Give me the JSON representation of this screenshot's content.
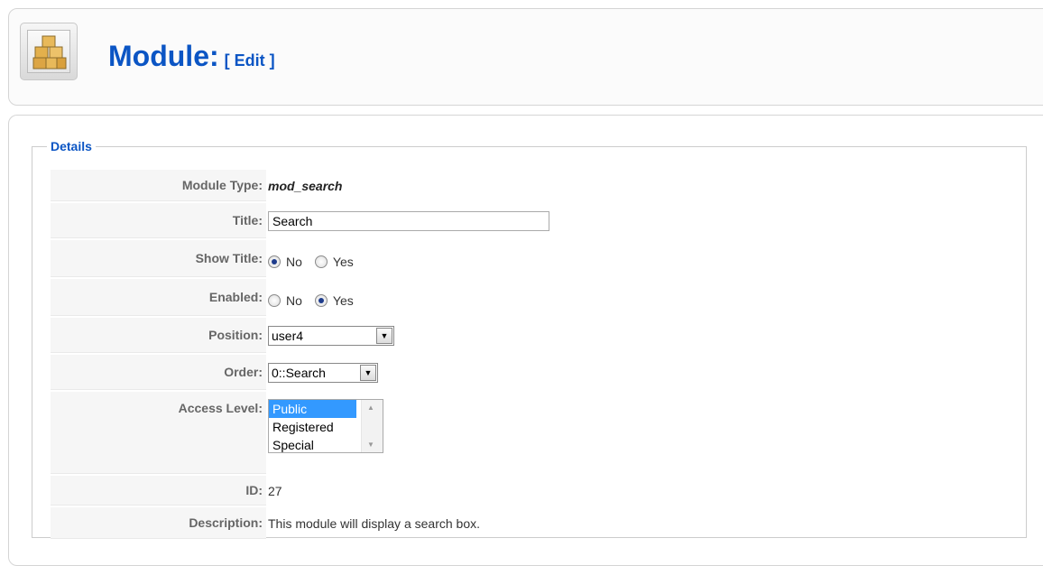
{
  "header": {
    "title": "Module:",
    "subtitle": "[ Edit ]"
  },
  "details": {
    "legend": "Details",
    "module_type": {
      "label": "Module Type:",
      "value": "mod_search"
    },
    "title": {
      "label": "Title:",
      "value": "Search"
    },
    "show_title": {
      "label": "Show Title:",
      "options": [
        "No",
        "Yes"
      ],
      "selected": "No"
    },
    "enabled": {
      "label": "Enabled:",
      "options": [
        "No",
        "Yes"
      ],
      "selected": "Yes"
    },
    "position": {
      "label": "Position:",
      "value": "user4"
    },
    "order": {
      "label": "Order:",
      "value": "0::Search"
    },
    "access_level": {
      "label": "Access Level:",
      "options": [
        "Public",
        "Registered",
        "Special"
      ],
      "selected": "Public"
    },
    "id": {
      "label": "ID:",
      "value": "27"
    },
    "description": {
      "label": "Description:",
      "value": "This module will display a search box."
    }
  },
  "colors": {
    "title": "#0b55c4",
    "selected_option": "#3399ff"
  },
  "icons": {
    "header": "module-cubes-icon"
  }
}
